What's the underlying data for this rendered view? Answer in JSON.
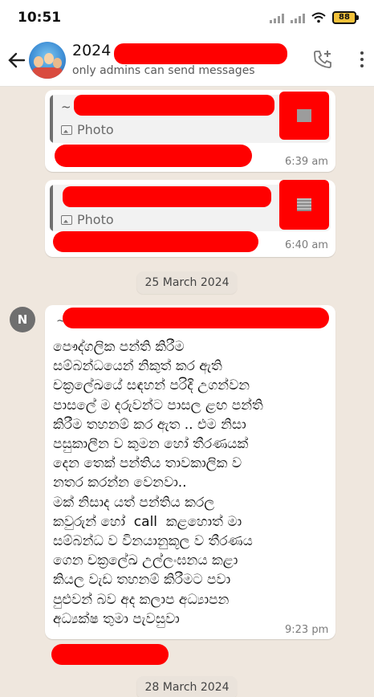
{
  "status_bar": {
    "time": "10:51",
    "battery": "88"
  },
  "header": {
    "title": "2024",
    "subtitle": "only admins can send messages"
  },
  "messages": [
    {
      "quote_tilde": "~",
      "quote_type": "Photo",
      "time": "6:39 am"
    },
    {
      "quote_type": "Photo",
      "time": "6:40 am"
    }
  ],
  "date_chips": [
    "25 March 2024",
    "28 March 2024"
  ],
  "message_main": {
    "sender_initial": "N",
    "tilde": "~",
    "text": "පෞද්ගලික පන්ති කිරීම\nසම්බන්ධයෙන් නිකුත් කර ඇති\nචක්‍රලේඛයේ සඳහන් පරිදි උගන්වන\nපාසලේ ම දරුවන්ට පාසල ළඟ පන්ති\nකිරීම තහනම් කර ඇත .. එම නිසා\nපසුකාලීන ව කුමන හෝ තීරණයක්\nදෙන තෙක් පන්තිය තාවකාලික ව\nනතර කරන්න වෙනවා..\nමක් නිසාද යත් පන්තිය කරල\nකවුරුන් හෝ  call  කළහොත් මා\nසම්බන්ධ ව විනයානුකූල ව තීරණය\nගෙන චක්‍රලේඛ උල්ලංඝනය කළා\nකියල වැඩ තහනම් කිරීමට පවා\nපුළුවන් බව අද කලාප අධ්‍යාපන\nඅධ්‍යක්ෂ තුමා පැවසුවා",
    "time": "9:23 pm"
  },
  "colors": {
    "chat_bg": "#efe7de",
    "redaction": "#ff0000",
    "bubble": "#ffffff"
  }
}
